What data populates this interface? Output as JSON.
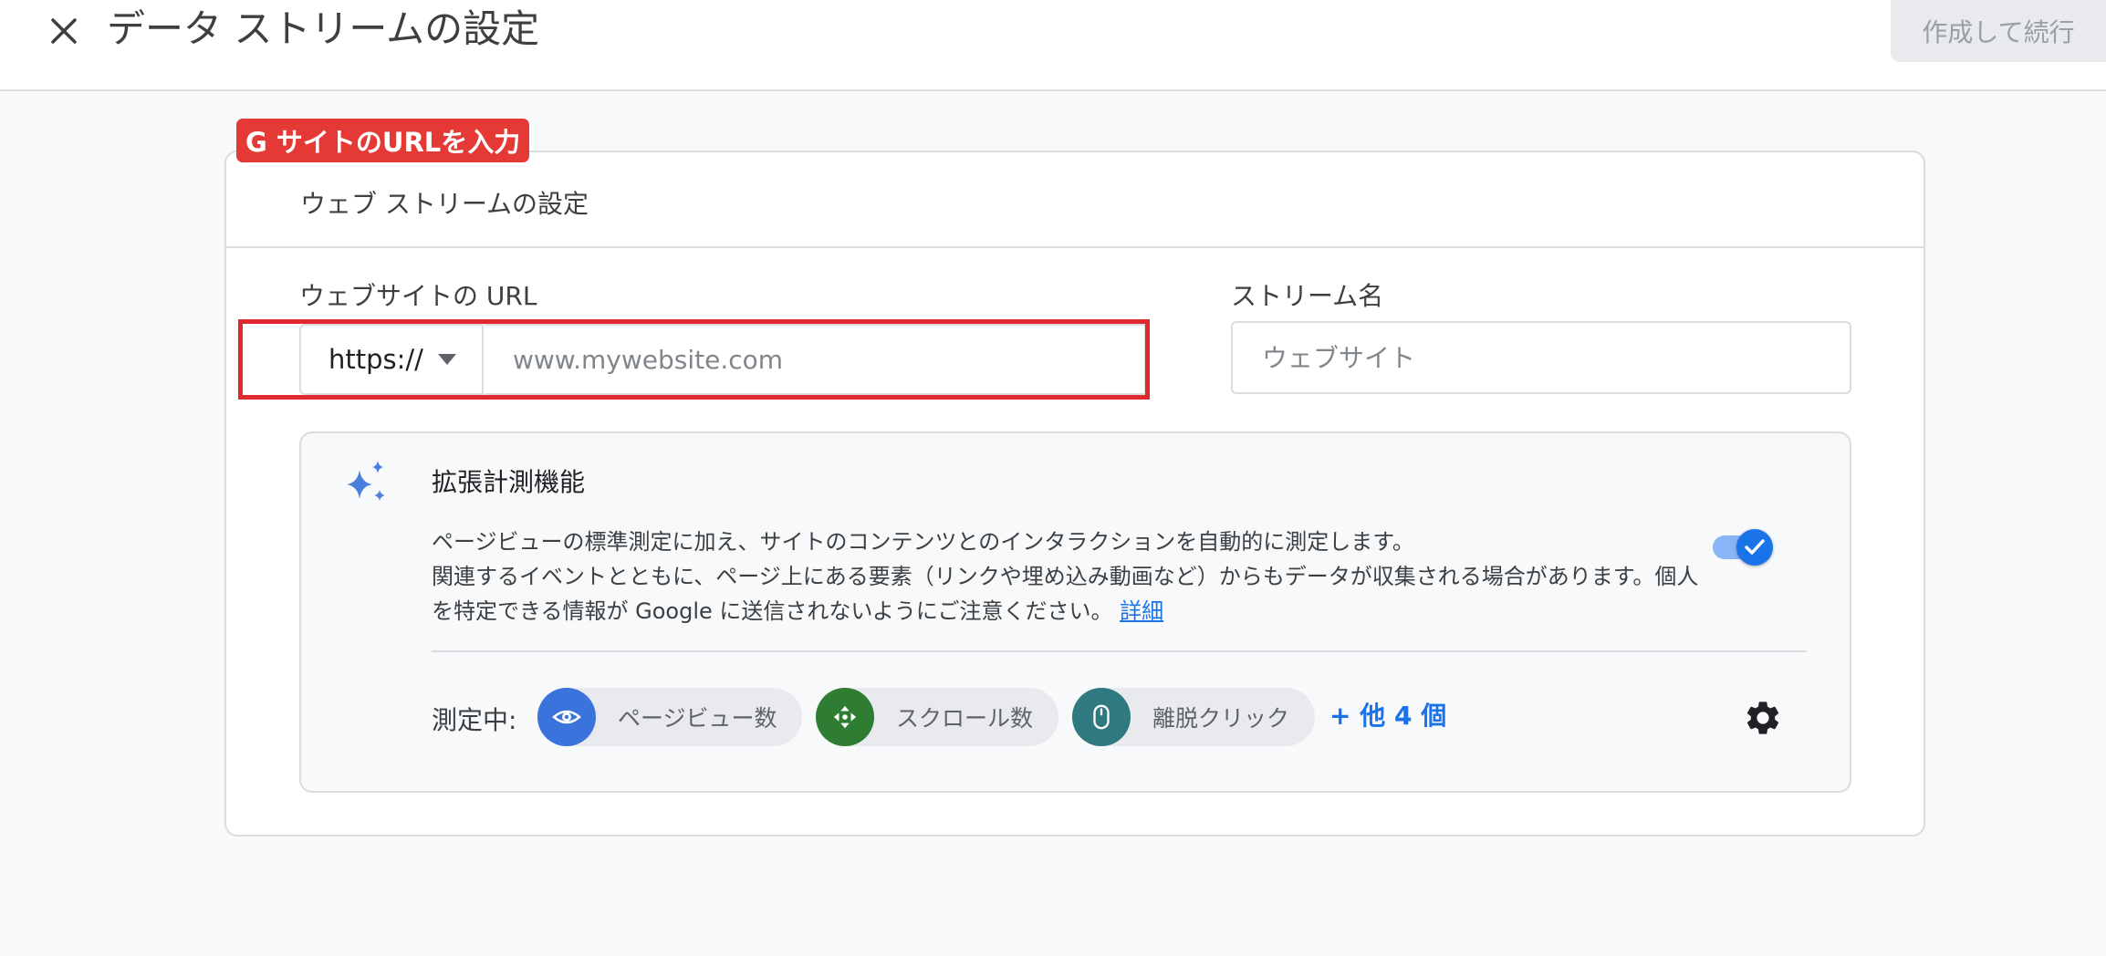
{
  "header": {
    "title": "データ ストリームの設定",
    "create_button": "作成して続行"
  },
  "annotation": {
    "badge": "G サイトのURLを入力"
  },
  "card": {
    "title": "ウェブ ストリームの設定",
    "url_label": "ウェブサイトの URL",
    "protocol": "https://",
    "url_placeholder": "www.mywebsite.com",
    "stream_name_label": "ストリーム名",
    "stream_name_placeholder": "ウェブサイト"
  },
  "enhanced_measurement": {
    "title": "拡張計測機能",
    "description_1": "ページビューの標準測定に加え、サイトのコンテンツとのインタラクションを自動的に測定します。",
    "description_2": "関連するイベントとともに、ページ上にある要素（リンクや埋め込み動画など）からもデータが収集される場合があります。個人を特定できる情報が Google に送信されないようにご注意ください。",
    "details_link": "詳細",
    "enabled": true,
    "measuring_label": "測定中:",
    "chips": [
      {
        "label": "ページビュー数",
        "icon": "eye-icon",
        "color": "#3b73dd"
      },
      {
        "label": "スクロール数",
        "icon": "scroll-icon",
        "color": "#2e7d32"
      },
      {
        "label": "離脱クリック",
        "icon": "mouse-icon",
        "color": "#2f7a80"
      }
    ],
    "more_link": "+ 他 4 個"
  },
  "colors": {
    "accent": "#1a73e8",
    "annotation_red": "#e53935"
  }
}
